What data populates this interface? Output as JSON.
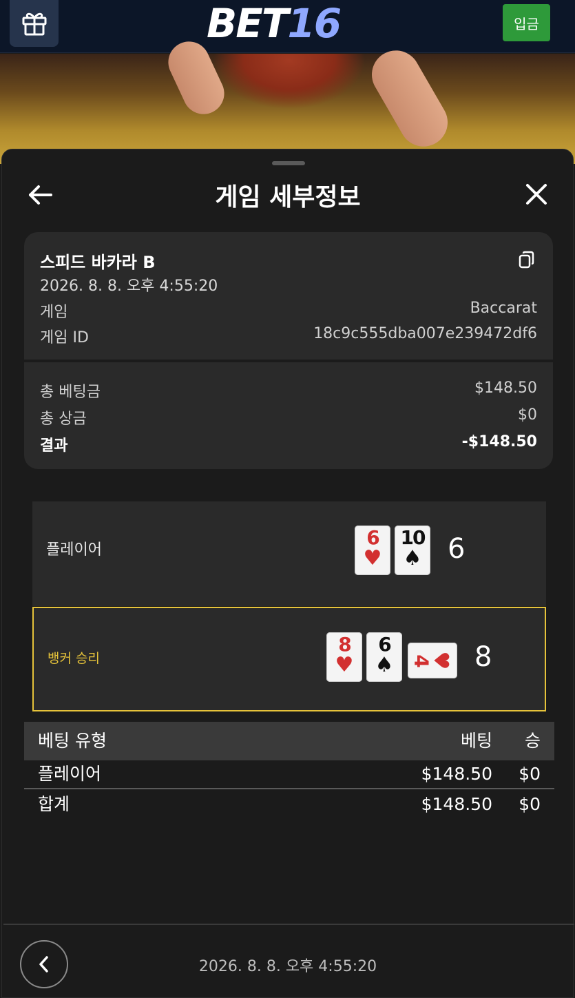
{
  "header": {
    "logo_main": "BET",
    "logo_num": "16",
    "deposit_label": "입금"
  },
  "sheet": {
    "title": "게임 세부정보"
  },
  "game": {
    "name": "스피드 바카라 B",
    "datetime": "2026. 8. 8. 오후 4:55:20",
    "type_label": "게임",
    "type_value": "Baccarat",
    "id_label": "게임 ID",
    "id_value": "18c9c555dba007e239472df6"
  },
  "summary": {
    "total_bet_label": "총 베팅금",
    "total_bet_value": "$148.50",
    "total_win_label": "총 상금",
    "total_win_value": "$0",
    "result_label": "결과",
    "result_value": "-$148.50"
  },
  "hands": {
    "player": {
      "label": "플레이어",
      "cards": [
        {
          "rank": "6",
          "suit": "♥",
          "color": "#d23030"
        },
        {
          "rank": "10",
          "suit": "♠",
          "color": "#111111"
        }
      ],
      "total": "6"
    },
    "banker": {
      "label": "뱅커 승리",
      "cards": [
        {
          "rank": "8",
          "suit": "♥",
          "color": "#d23030"
        },
        {
          "rank": "6",
          "suit": "♠",
          "color": "#111111"
        },
        {
          "rank": "4",
          "suit": "♥",
          "color": "#d23030"
        }
      ],
      "total": "8"
    },
    "winner_color": "#e6c33a"
  },
  "bets": {
    "headers": [
      "베팅 유형",
      "베팅",
      "승"
    ],
    "rows": [
      [
        "플레이어",
        "$148.50",
        "$0"
      ]
    ],
    "total": [
      "합계",
      "$148.50",
      "$0"
    ]
  },
  "footer": {
    "datetime": "2026. 8. 8. 오후 4:55:20"
  }
}
